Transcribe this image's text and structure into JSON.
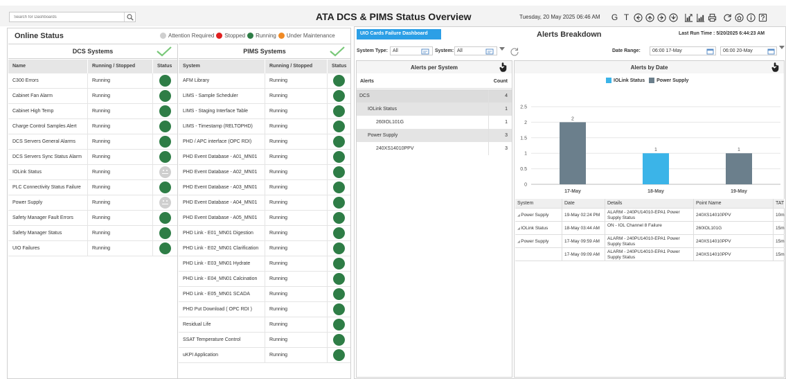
{
  "search": {
    "placeholder": "Search for Dashboards"
  },
  "page_title": "ATA DCS & PIMS Status Overview",
  "datetime": "Tuesday, 20 May 2025 06:46 AM",
  "toolbar": {
    "g_label": "G",
    "t_label": "T"
  },
  "online_status": {
    "title": "Online Status",
    "legend": [
      {
        "label": "Attention Required",
        "color": "#cfcfcf"
      },
      {
        "label": "Stopped",
        "color": "#e02020"
      },
      {
        "label": "Running",
        "color": "#2e7d46"
      },
      {
        "label": "Under Maintenance",
        "color": "#f08a24"
      }
    ]
  },
  "dcs": {
    "title": "DCS Systems",
    "columns": [
      "Name",
      "Running / Stopped",
      "Status"
    ],
    "rows": [
      {
        "name": "C300 Errors",
        "state": "Running",
        "status": "running"
      },
      {
        "name": "Cabinet Fan Alarm",
        "state": "Running",
        "status": "running"
      },
      {
        "name": "Cabinet High Temp",
        "state": "Running",
        "status": "running"
      },
      {
        "name": "Charge Control Samples Alert",
        "state": "Running",
        "status": "running"
      },
      {
        "name": "DCS Servers General Alarms",
        "state": "Running",
        "status": "running"
      },
      {
        "name": "DCS Servers Sync Status Alarm",
        "state": "Running",
        "status": "running"
      },
      {
        "name": "IOLink Status",
        "state": "Running",
        "status": "attention"
      },
      {
        "name": "PLC Connectivity Status Failure",
        "state": "Running",
        "status": "running"
      },
      {
        "name": "Power Supply",
        "state": "Running",
        "status": "attention"
      },
      {
        "name": "Safety Manager Fault Errors",
        "state": "Running",
        "status": "running"
      },
      {
        "name": "Safety Manager Status",
        "state": "Running",
        "status": "running"
      },
      {
        "name": "UIO Failures",
        "state": "Running",
        "status": "running"
      }
    ]
  },
  "pims": {
    "title": "PIMS Systems",
    "columns": [
      "System",
      "Running / Stopped",
      "Status"
    ],
    "rows": [
      {
        "name": "AFM Library",
        "state": "Running",
        "status": "running"
      },
      {
        "name": "LIMS - Sample Scheduler",
        "state": "Running",
        "status": "running"
      },
      {
        "name": "LIMS - Staging Interface Table",
        "state": "Running",
        "status": "running"
      },
      {
        "name": "LIMS - Timestamp (RELTOPHD)",
        "state": "Running",
        "status": "running"
      },
      {
        "name": "PHD / APC interface (OPC RDI)",
        "state": "Running",
        "status": "running"
      },
      {
        "name": "PHD Event Database - A01_MN01",
        "state": "Running",
        "status": "running"
      },
      {
        "name": "PHD Event Database - A02_MN01",
        "state": "Running",
        "status": "running"
      },
      {
        "name": "PHD Event Database - A03_MN01",
        "state": "Running",
        "status": "running"
      },
      {
        "name": "PHD Event Database - A04_MN01",
        "state": "Running",
        "status": "running"
      },
      {
        "name": "PHD Event Database - A05_MN01",
        "state": "Running",
        "status": "running"
      },
      {
        "name": "PHD Link - E01_MN01 Digestion",
        "state": "Running",
        "status": "running"
      },
      {
        "name": "PHD Link - E02_MN01 Clarification",
        "state": "Running",
        "status": "running"
      },
      {
        "name": "PHD Link - E03_MN01 Hydrate",
        "state": "Running",
        "status": "running"
      },
      {
        "name": "PHD Link - E04_MN01 Calcination",
        "state": "Running",
        "status": "running"
      },
      {
        "name": "PHD Link - E05_MN01 SCADA",
        "state": "Running",
        "status": "running"
      },
      {
        "name": "PHD Put Download ( OPC RDI )",
        "state": "Running",
        "status": "running"
      },
      {
        "name": "Residual Life",
        "state": "Running",
        "status": "running"
      },
      {
        "name": "SSAT Temperature Control",
        "state": "Running",
        "status": "running"
      },
      {
        "name": "uKPI Application",
        "state": "Running",
        "status": "running"
      }
    ]
  },
  "right": {
    "tab": "UIO Cards Failure Dashboard",
    "title": "Alerts Breakdown",
    "last_run_label": "Last Run Time :",
    "last_run_value": "5/20/2025 6:44:23 AM",
    "filters": {
      "system_type_label": "System Type:",
      "system_type_value": "All",
      "system_label": "System:",
      "system_value": "All",
      "date_range_label": "Date Range:",
      "date_from": "06:00 17-May",
      "date_to": "06:00 20-May"
    },
    "alerts_per_system": {
      "title": "Alerts per System",
      "col_alerts": "Alerts",
      "col_count": "Count",
      "rows": [
        {
          "name": "DCS",
          "count": "4",
          "level": 0
        },
        {
          "name": "IOLink Status",
          "count": "1",
          "level": 1
        },
        {
          "name": "260IOL101G",
          "count": "1",
          "level": 2
        },
        {
          "name": "Power Supply",
          "count": "3",
          "level": 1
        },
        {
          "name": "240XS14010PPV",
          "count": "3",
          "level": 2
        }
      ]
    },
    "alerts_by_date": {
      "title": "Alerts by Date",
      "table": {
        "columns": [
          "System",
          "Date",
          "Details",
          "Point Name",
          "TAT"
        ],
        "rows": [
          {
            "system": "Power Supply",
            "date": "19-May 02:24 PM",
            "details": "ALARM - 240PU14010-EPA1 Power Supply Status",
            "point": "240XS14010PPV",
            "tat": "10m"
          },
          {
            "system": "IOLink Status",
            "date": "18-May 03:44 AM",
            "details": "ON - IOL Channel 8 Failure",
            "point": "260IOL101G",
            "tat": "15m"
          },
          {
            "system": "Power Supply",
            "date": "17-May 09:59 AM",
            "details": "ALARM - 240PU14010-EPA1 Power Supply Status",
            "point": "240XS14010PPV",
            "tat": "15m"
          },
          {
            "system": "",
            "date": "17-May 09:09 AM",
            "details": "ALARM - 240PU14010-EPA1 Power Supply Status",
            "point": "240XS14010PPV",
            "tat": "15m"
          }
        ]
      }
    }
  },
  "chart_data": {
    "type": "bar",
    "title": "Alerts by Date",
    "categories": [
      "17-May",
      "18-May",
      "19-May"
    ],
    "series": [
      {
        "name": "IOLink Status",
        "color": "#3bb4e8",
        "values": [
          0,
          1,
          0
        ]
      },
      {
        "name": "Power Supply",
        "color": "#6b7f8c",
        "values": [
          2,
          0,
          1
        ]
      }
    ],
    "data_labels": [
      {
        "category": "17-May",
        "series": "Power Supply",
        "label": "2"
      },
      {
        "category": "18-May",
        "series": "IOLink Status",
        "label": "1"
      },
      {
        "category": "19-May",
        "series": "Power Supply",
        "label": "1"
      }
    ],
    "ylim": [
      0,
      2.5
    ],
    "yticks": [
      "0",
      "0.5",
      "1",
      "1.5",
      "2",
      "2.5"
    ],
    "grid": true,
    "legend": "top"
  }
}
